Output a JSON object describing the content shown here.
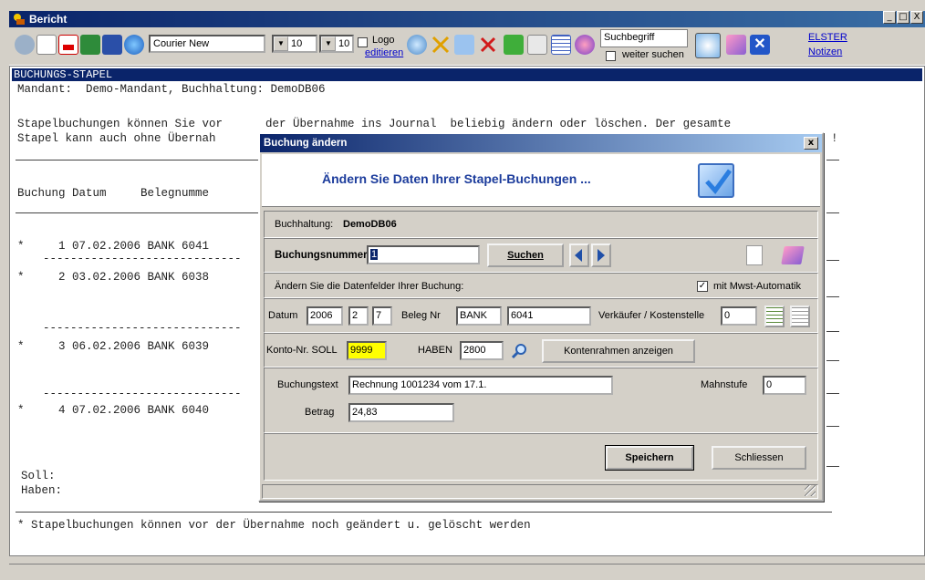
{
  "window": {
    "title": "Bericht",
    "font_name": "Courier New",
    "font_size_1": "10",
    "font_size_2": "10",
    "logo_label": "Logo",
    "edit_link": "editieren",
    "search_placeholder": "Suchbegriff",
    "weiter_suchen": "weiter suchen",
    "elster_link": "ELSTER",
    "notes_link": "Notizen",
    "controls": [
      "_",
      "□",
      "X"
    ]
  },
  "report": {
    "header": "BUCHUNGS-STAPEL",
    "mandant_line": "Mandant:  Demo-Mandant, Buchhaltung: DemoDB06",
    "info_line1_left": "Stapelbuchungen können Sie vor",
    "info_line1_right": "der Übernahme ins Journal  beliebig ändern oder löschen. Der gesamte",
    "info_line2_left": "Stapel kann auch ohne Übernah",
    "info_line2_right": "!",
    "col_header": "Buchung Datum     Belegnumme",
    "rows": [
      "*     1 07.02.2006 BANK 6041",
      "*     2 03.02.2006 BANK 6038",
      "*     3 06.02.2006 BANK 6039",
      "*     4 07.02.2006 BANK 6040"
    ],
    "dashes": "-----------------------------",
    "soll_label": "Soll:",
    "haben_label": "Haben:",
    "footer_note": "* Stapelbuchungen können vor der Übernahme noch geändert u. gelöscht werden"
  },
  "dialog": {
    "title": "Buchung ändern",
    "close": "x",
    "banner": "Ändern Sie Daten Ihrer Stapel-Buchungen ...",
    "buchhaltung_label": "Buchhaltung:",
    "buchhaltung_value": "DemoDB06",
    "buchungsnummer_label": "Buchungsnummer",
    "buchungsnummer_value": "1",
    "suchen_button": "Suchen",
    "aendern_label": "Ändern Sie die Datenfelder Ihrer Buchung:",
    "mwst_label": "mit Mwst-Automatik",
    "mwst_checked": "✓",
    "datum_label": "Datum",
    "datum_year": "2006",
    "datum_month": "2",
    "datum_day": "7",
    "beleg_label": "Beleg Nr",
    "beleg_prefix": "BANK",
    "beleg_number": "6041",
    "verkaeufer_label": "Verkäufer / Kostenstelle",
    "verkaeufer_value": "0",
    "konto_soll_label": "Konto-Nr. SOLL",
    "konto_soll_value": "9999",
    "haben_label": "HABEN",
    "haben_value": "2800",
    "kontenrahmen_button": "Kontenrahmen anzeigen",
    "buchungstext_label": "Buchungstext",
    "buchungstext_value": "Rechnung 1001234 vom 17.1.",
    "mahnstufe_label": "Mahnstufe",
    "mahnstufe_value": "0",
    "betrag_label": "Betrag",
    "betrag_value": "24,83",
    "speichern_button": "Speichern",
    "schliessen_button": "Schliessen"
  },
  "colors": {
    "titlebar": "#0a246a",
    "highlight_input": "#ffff00",
    "banner_text": "#1c3c9c"
  }
}
